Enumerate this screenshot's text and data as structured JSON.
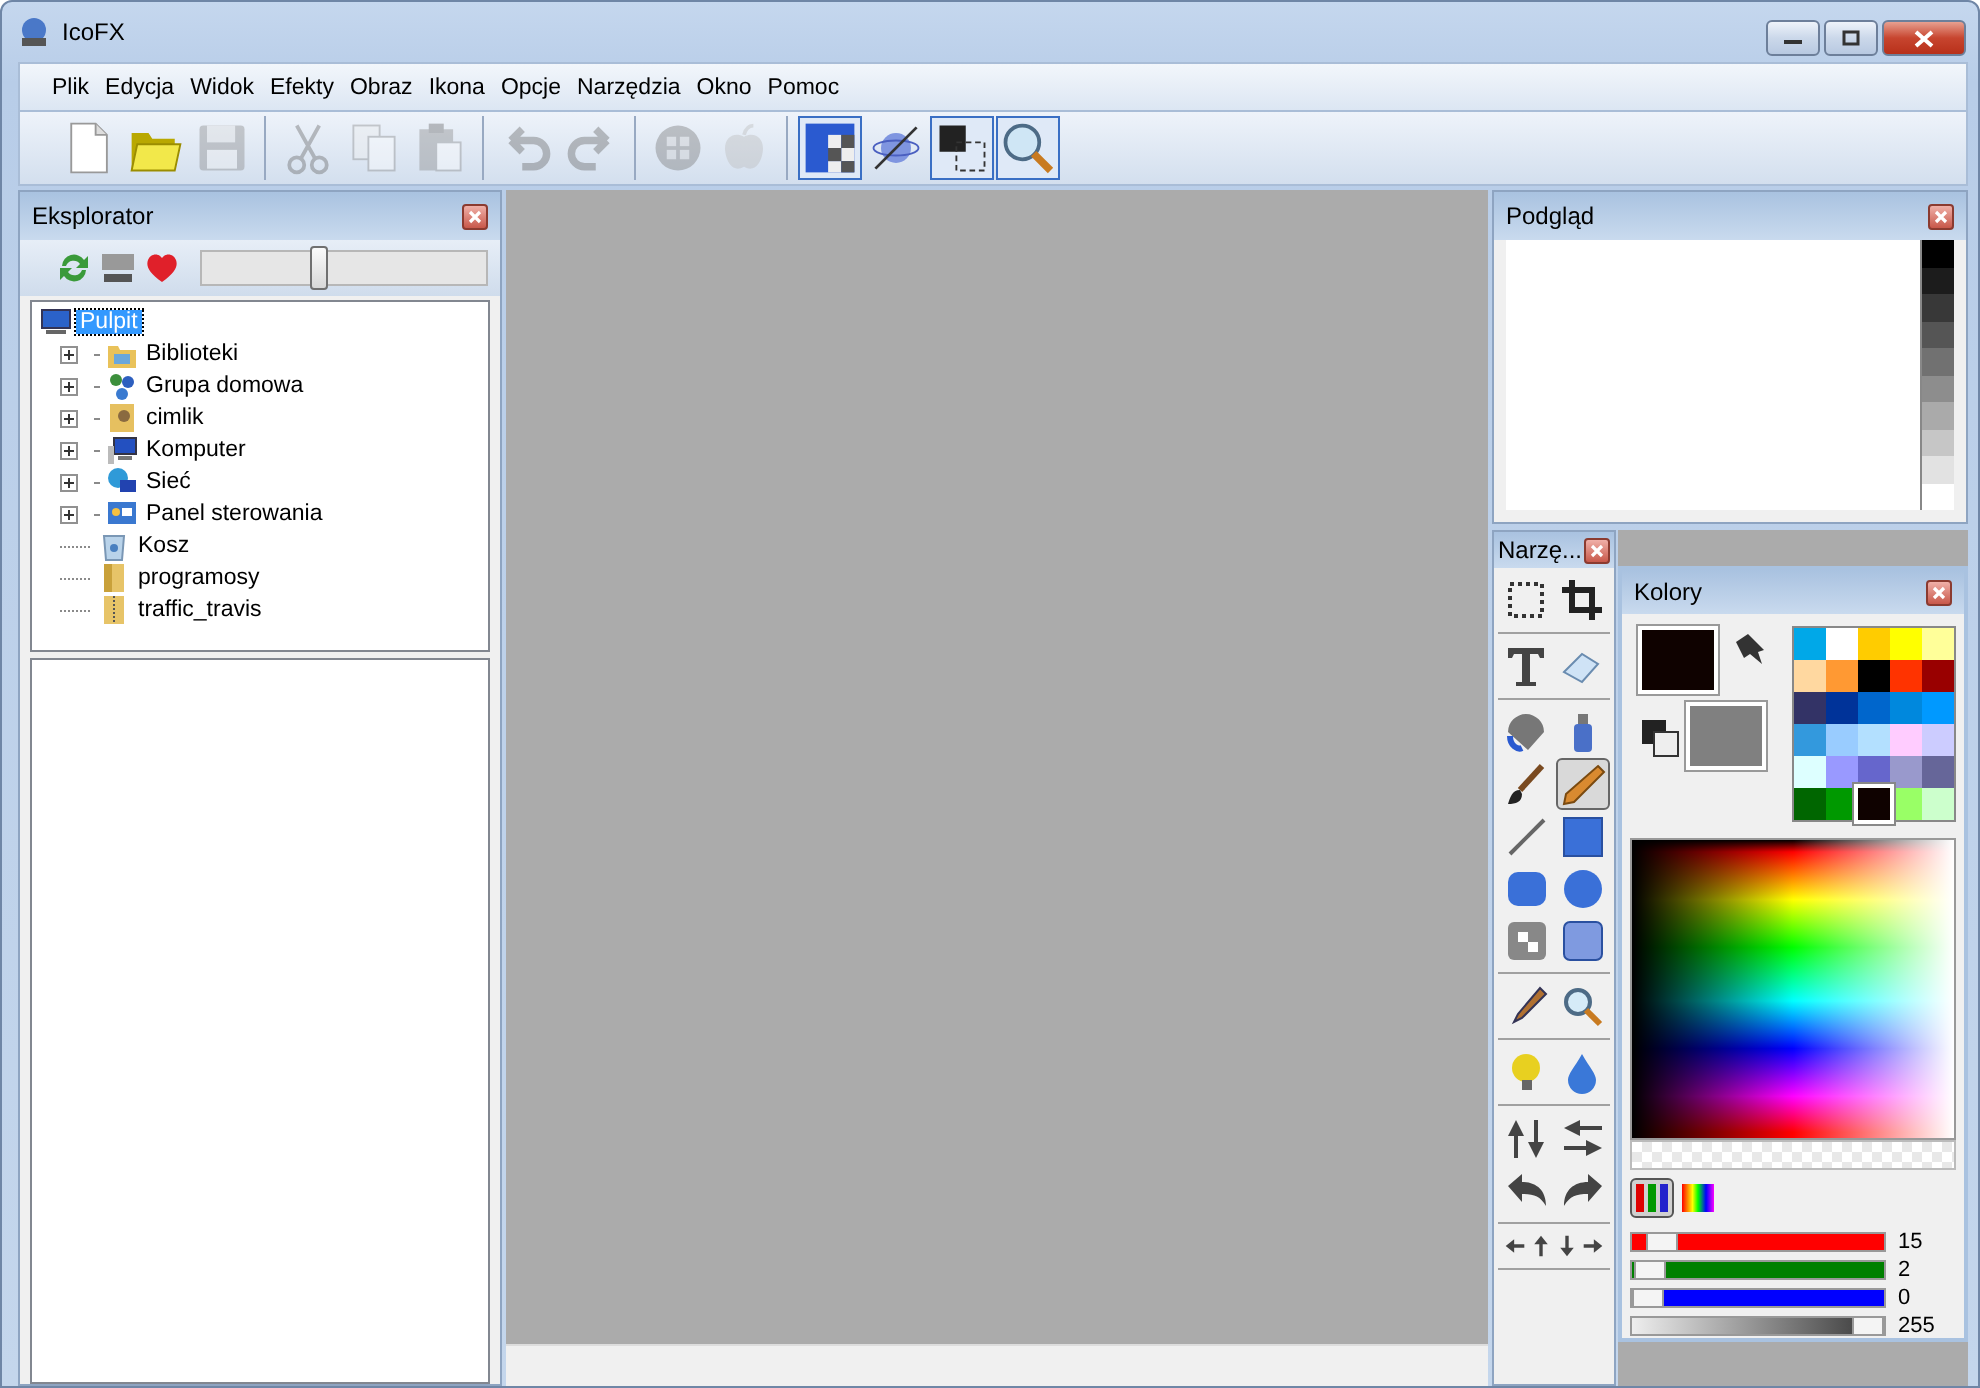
{
  "window": {
    "title": "IcoFX"
  },
  "menu": [
    {
      "label": "Plik"
    },
    {
      "label": "Edycja"
    },
    {
      "label": "Widok"
    },
    {
      "label": "Efekty"
    },
    {
      "label": "Obraz"
    },
    {
      "label": "Ikona"
    },
    {
      "label": "Opcje"
    },
    {
      "label": "Narzędzia"
    },
    {
      "label": "Okno"
    },
    {
      "label": "Pomoc"
    }
  ],
  "toolbar": {
    "groups": [
      [
        {
          "disabled": false,
          "selected": false
        },
        {
          "disabled": false,
          "selected": false
        },
        {
          "disabled": true,
          "selected": false
        }
      ],
      [
        {
          "disabled": true,
          "selected": false
        },
        {
          "disabled": true,
          "selected": false
        },
        {
          "disabled": true,
          "selected": false
        }
      ],
      [
        {
          "disabled": true,
          "selected": false
        },
        {
          "disabled": true,
          "selected": false
        }
      ],
      [
        {
          "disabled": true,
          "selected": false
        },
        {
          "disabled": true,
          "selected": false
        }
      ],
      [
        {
          "disabled": false,
          "selected": true
        },
        {
          "disabled": false,
          "selected": false
        },
        {
          "disabled": false,
          "selected": true
        },
        {
          "disabled": false,
          "selected": true
        }
      ]
    ]
  },
  "explorer": {
    "title": "Eksplorator",
    "zoom": {
      "level": 0.41
    },
    "tree": [
      {
        "label": "Pulpit",
        "selected": true,
        "children": [
          {
            "label": "Biblioteki",
            "selected": false,
            "expandable": true
          },
          {
            "label": "Grupa domowa",
            "selected": false,
            "expandable": true
          },
          {
            "label": "cimlik",
            "selected": false,
            "expandable": true
          },
          {
            "label": "Komputer",
            "selected": false,
            "expandable": true
          },
          {
            "label": "Sieć",
            "selected": false,
            "expandable": true
          },
          {
            "label": "Panel sterowania",
            "selected": false,
            "expandable": true
          },
          {
            "label": "Kosz",
            "selected": false,
            "expandable": false
          },
          {
            "label": "programosy",
            "selected": false,
            "expandable": false
          },
          {
            "label": "traffic_travis",
            "selected": false,
            "expandable": false
          }
        ]
      }
    ]
  },
  "preview": {
    "title": "Podgląd",
    "shades": [
      {
        "color": "#000000"
      },
      {
        "color": "#1c1c1c"
      },
      {
        "color": "#383838"
      },
      {
        "color": "#555555"
      },
      {
        "color": "#717171"
      },
      {
        "color": "#8d8d8d"
      },
      {
        "color": "#aaaaaa"
      },
      {
        "color": "#c6c6c6"
      },
      {
        "color": "#e2e2e2"
      },
      {
        "color": "#ffffff"
      }
    ]
  },
  "tools": {
    "title": "Narzę...",
    "groups": [
      [
        {
          "selected": false
        },
        {
          "selected": false
        }
      ],
      [
        {
          "selected": false
        },
        {
          "selected": false
        }
      ],
      [
        {
          "selected": false
        },
        {
          "selected": false
        },
        {
          "selected": false
        },
        {
          "selected": true
        },
        {
          "selected": false
        },
        {
          "selected": false
        },
        {
          "selected": false
        },
        {
          "selected": false
        },
        {
          "selected": false
        },
        {
          "selected": false
        }
      ],
      [
        {
          "selected": false
        },
        {
          "selected": false
        }
      ],
      [
        {
          "selected": false
        },
        {
          "selected": false
        }
      ],
      [
        {
          "selected": false
        },
        {
          "selected": false
        },
        {
          "selected": false
        },
        {
          "selected": false
        }
      ],
      [
        {
          "selected": false
        },
        {
          "selected": false
        },
        {
          "selected": false
        },
        {
          "selected": false
        }
      ]
    ]
  },
  "colors": {
    "title": "Kolory",
    "foreground": {
      "color": "#0f0200"
    },
    "background": {
      "color": "#808080"
    },
    "palette": [
      {
        "color": "#00a8e8",
        "selected": false
      },
      {
        "color": "#ffffff",
        "selected": false
      },
      {
        "color": "#ffcc00",
        "selected": false
      },
      {
        "color": "#ffff00",
        "selected": false
      },
      {
        "color": "#ffff99",
        "selected": false
      },
      {
        "color": "#ffd8a0",
        "selected": false
      },
      {
        "color": "#ff9933",
        "selected": false
      },
      {
        "color": "#000000",
        "selected": false
      },
      {
        "color": "#ff3300",
        "selected": false
      },
      {
        "color": "#990000",
        "selected": false
      },
      {
        "color": "#333366",
        "selected": false
      },
      {
        "color": "#003399",
        "selected": false
      },
      {
        "color": "#0066cc",
        "selected": false
      },
      {
        "color": "#0088dd",
        "selected": false
      },
      {
        "color": "#0099ff",
        "selected": false
      },
      {
        "color": "#3399dd",
        "selected": false
      },
      {
        "color": "#99ccff",
        "selected": false
      },
      {
        "color": "#b3e0ff",
        "selected": false
      },
      {
        "color": "#ffccff",
        "selected": false
      },
      {
        "color": "#ccccff",
        "selected": false
      },
      {
        "color": "#ddffff",
        "selected": false
      },
      {
        "color": "#9999ff",
        "selected": false
      },
      {
        "color": "#6666cc",
        "selected": false
      },
      {
        "color": "#9999cc",
        "selected": false
      },
      {
        "color": "#666699",
        "selected": false
      },
      {
        "color": "#006600",
        "selected": false
      },
      {
        "color": "#009900",
        "selected": false
      },
      {
        "color": "#0f0200",
        "selected": true
      },
      {
        "color": "#99ff66",
        "selected": false
      },
      {
        "color": "#ccffcc",
        "selected": false
      }
    ],
    "modes": [
      {
        "selected": true
      },
      {
        "selected": false
      }
    ],
    "sliders": [
      {
        "kind": "channel",
        "color": "#ff0000",
        "level": 0.06,
        "reading": "15"
      },
      {
        "kind": "channel",
        "color": "#008000",
        "level": 0.01,
        "reading": "2"
      },
      {
        "kind": "channel",
        "color": "#0000ff",
        "level": 0,
        "reading": "0"
      },
      {
        "kind": "alpha",
        "level": 1,
        "reading": "255"
      }
    ]
  }
}
